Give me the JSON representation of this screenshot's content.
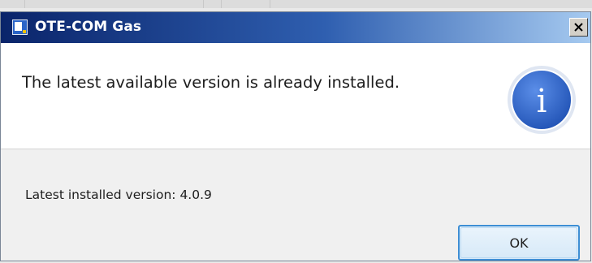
{
  "window": {
    "title": "OTE-COM Gas",
    "app_icon": "application-window-icon",
    "close_icon": "close-icon",
    "close_symbol": "✕"
  },
  "message": {
    "text": "The latest available version is already installed.",
    "icon": "info-icon",
    "icon_glyph": "i"
  },
  "details": {
    "text": "Latest installed version: 4.0.9"
  },
  "buttons": {
    "ok_label": "OK"
  },
  "colors": {
    "titlebar_start": "#0a246a",
    "titlebar_end": "#a6caf0",
    "info_icon_fill": "#3b6fd0",
    "ok_border": "#3d8ed4",
    "footer_bg": "#f0f0f0"
  }
}
